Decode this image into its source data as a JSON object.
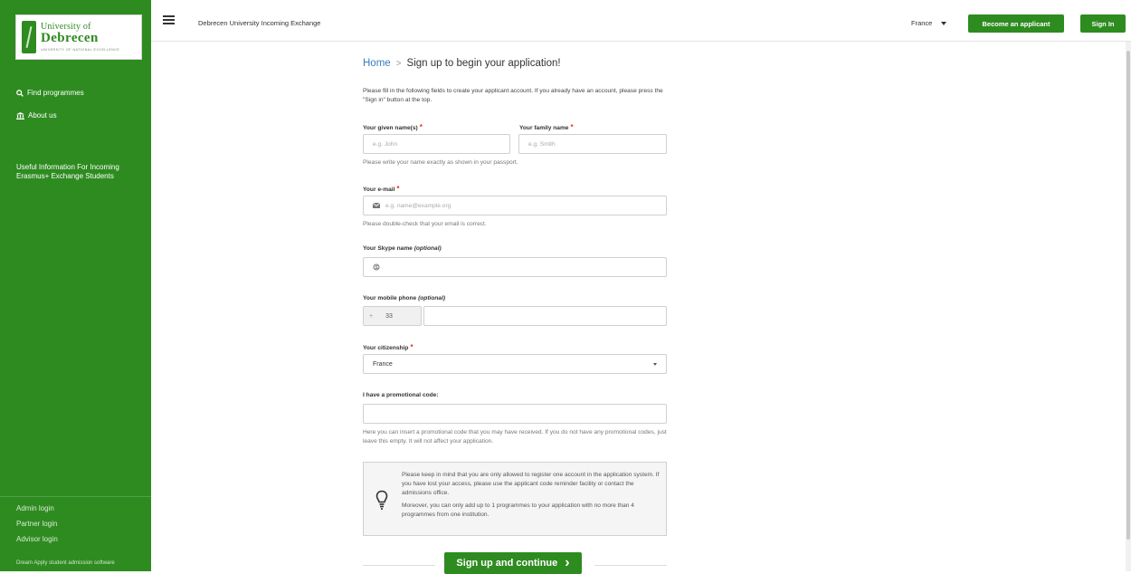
{
  "sidebar": {
    "logo": {
      "top": "University of",
      "main": "Debrecen",
      "sub": "UNIVERSITY OF NATIONAL EXCELLENCE"
    },
    "nav": [
      {
        "label": "Find programmes",
        "icon": "search-icon"
      },
      {
        "label": "About us",
        "icon": "institution-icon"
      }
    ],
    "info_link": "Useful Information For Incoming Erasmus+ Exchange Students",
    "bottom_links": [
      "Admin login",
      "Partner login",
      "Advisor login"
    ],
    "footer": "Dream Apply student admission software"
  },
  "topbar": {
    "title": "Debrecen University Incoming Exchange",
    "country": "France",
    "become_label": "Become an applicant",
    "signin_label": "Sign In"
  },
  "breadcrumb": {
    "home": "Home",
    "separator": ">",
    "current": "Sign up to begin your application!"
  },
  "form": {
    "intro": "Please fill in the following fields to create your applicant account. If you already have an account, please press the \"Sign in\" button at the top.",
    "given_name": {
      "label": "Your given name(s)",
      "placeholder": "e.g. John"
    },
    "family_name": {
      "label": "Your family name",
      "placeholder": "e.g. Smith"
    },
    "name_help": "Please write your name exactly as shown in your passport.",
    "email": {
      "label": "Your e-mail",
      "placeholder": "e.g. name@example.org"
    },
    "email_help": "Please double-check that your email is correct.",
    "skype": {
      "label": "Your Skype name",
      "optional": "(optional)"
    },
    "phone": {
      "label": "Your mobile phone",
      "optional": "(optional)",
      "plus": "+",
      "code": "33"
    },
    "citizenship": {
      "label": "Your citizenship",
      "value": "France"
    },
    "promo": {
      "label": "I have a promotional code:"
    },
    "promo_help": "Here you can insert a promotional code that you may have received. If you do not have any promotional codes, just leave this empty. It will not affect your application.",
    "required_mark": "*"
  },
  "notice": {
    "p1": "Please keep in mind that you are only allowed to register one account in the application system. If you have lost your access, please use the applicant code reminder facility or contact the admissions office.",
    "p2": "Moreover, you can only add up to 1 programmes to your application with no more than 4 programmes from one institution."
  },
  "submit": {
    "label": "Sign up and continue",
    "arrow": "›"
  },
  "colors": {
    "brand": "#2e8b20",
    "link": "#3a7bbf",
    "required": "#e0342b"
  }
}
